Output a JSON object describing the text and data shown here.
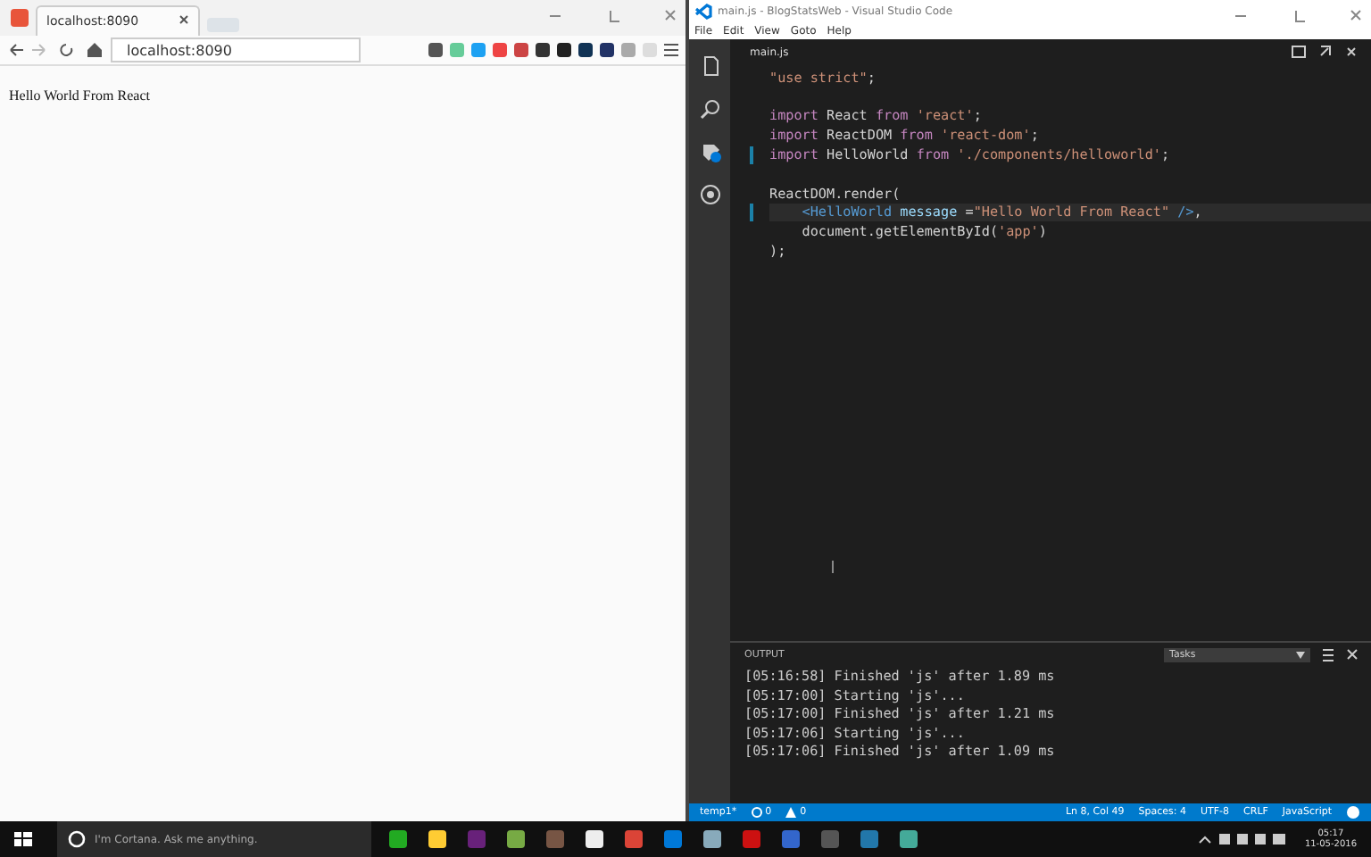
{
  "browser": {
    "tab": {
      "title": "localhost:8090"
    },
    "address": {
      "value": "localhost:8090"
    },
    "page_text": "Hello World From React"
  },
  "editor_window": {
    "title": "main.js - BlogStatsWeb - Visual Studio Code",
    "menu": [
      "File",
      "Edit",
      "View",
      "Goto",
      "Help"
    ],
    "tab": {
      "title": "main.js"
    },
    "code_lines": [
      {
        "changed": false,
        "current": false,
        "tokens": [
          {
            "kind": "string",
            "text": "\"use strict\""
          },
          {
            "kind": "plain",
            "text": ";"
          }
        ]
      },
      {
        "changed": false,
        "current": false
      },
      {
        "changed": false,
        "current": false,
        "tokens": [
          {
            "kind": "keyword",
            "text": "import"
          },
          {
            "kind": "plain",
            "text": " React "
          },
          {
            "kind": "keyword",
            "text": "from "
          },
          {
            "kind": "string",
            "text": "'react'"
          },
          {
            "kind": "plain",
            "text": ";"
          }
        ]
      },
      {
        "changed": false,
        "current": false,
        "tokens": [
          {
            "kind": "keyword",
            "text": "import"
          },
          {
            "kind": "plain",
            "text": " ReactDOM "
          },
          {
            "kind": "keyword",
            "text": "from "
          },
          {
            "kind": "string",
            "text": "'react-dom'"
          },
          {
            "kind": "plain",
            "text": ";"
          }
        ]
      },
      {
        "changed": true,
        "current": false,
        "tokens": [
          {
            "kind": "keyword",
            "text": "import"
          },
          {
            "kind": "plain",
            "text": " HelloWorld "
          },
          {
            "kind": "keyword",
            "text": "from "
          },
          {
            "kind": "string",
            "text": "'./components/helloworld'"
          },
          {
            "kind": "plain",
            "text": ";"
          }
        ]
      },
      {
        "changed": false,
        "current": false
      },
      {
        "changed": false,
        "current": false,
        "tokens": [
          {
            "kind": "plain",
            "text": "ReactDOM.render("
          }
        ]
      },
      {
        "changed": true,
        "current": true,
        "tokens": [
          {
            "kind": "tag",
            "text": "    <HelloWorld"
          },
          {
            "kind": "attr",
            "text": " message"
          },
          {
            "kind": "plain",
            "text": " ="
          },
          {
            "kind": "string",
            "text": "\"Hello World From React\""
          },
          {
            "kind": "tag",
            "text": " />"
          },
          {
            "kind": "plain",
            "text": ","
          }
        ]
      },
      {
        "changed": false,
        "current": false,
        "tokens": [
          {
            "kind": "plain",
            "text": "    document.getElementById("
          },
          {
            "kind": "string",
            "text": "'app'"
          },
          {
            "kind": "plain",
            "text": ")"
          }
        ]
      },
      {
        "changed": false,
        "current": false,
        "tokens": [
          {
            "kind": "plain",
            "text": ");"
          }
        ]
      }
    ],
    "output": {
      "title": "OUTPUT",
      "channel": "Tasks",
      "lines": [
        "[05:16:58] Finished 'js' after 1.89 ms",
        "[05:17:00] Starting 'js'...",
        "[05:17:00] Finished 'js' after 1.21 ms",
        "[05:17:06] Starting 'js'...",
        "[05:17:06] Finished 'js' after 1.09 ms"
      ]
    },
    "status_bar": {
      "branch": "temp1*",
      "errors": "0",
      "warnings": "0",
      "position": "Ln 8, Col 49",
      "indent": "Spaces: 4",
      "encoding": "UTF-8",
      "line_ending": "CRLF",
      "language": "JavaScript"
    }
  },
  "taskbar": {
    "search_placeholder": "I'm Cortana. Ask me anything.",
    "time": "05:17",
    "date": "11-05-2016"
  }
}
